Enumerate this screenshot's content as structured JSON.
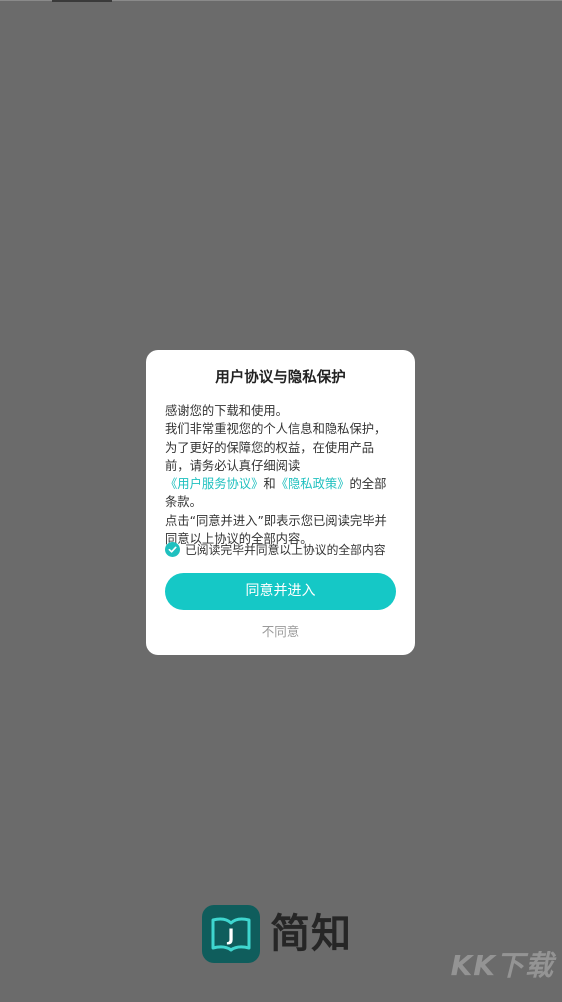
{
  "dialog": {
    "title": "用户协议与隐私保护",
    "greeting": "感谢您的下载和使用。",
    "body_part1": "我们非常重视您的个人信息和隐私保护，为了更好的保障您的权益，在使用产品前，请务必认真仔细阅读",
    "user_agreement_link": "《用户服务协议》",
    "and_text": "和",
    "privacy_link": "《隐私政策》",
    "body_part2": "的全部条款。",
    "body_part3": "点击“同意并进入”即表示您已阅读完毕并同意以上协议的全部内容。",
    "consent_label": "已阅读完毕并同意以上协议的全部内容",
    "consent_checked": true,
    "agree_label": "同意并进入",
    "disagree_label": "不同意"
  },
  "brand": {
    "name": "简知",
    "logo_letter": "J",
    "logo_icon": "book-icon"
  },
  "watermark": {
    "text": "KK下载"
  },
  "colors": {
    "accent": "#15c8c6",
    "link": "#1fc0bf",
    "overlay": "#6b6b6b",
    "logo_bg": "#0f5d5c"
  }
}
